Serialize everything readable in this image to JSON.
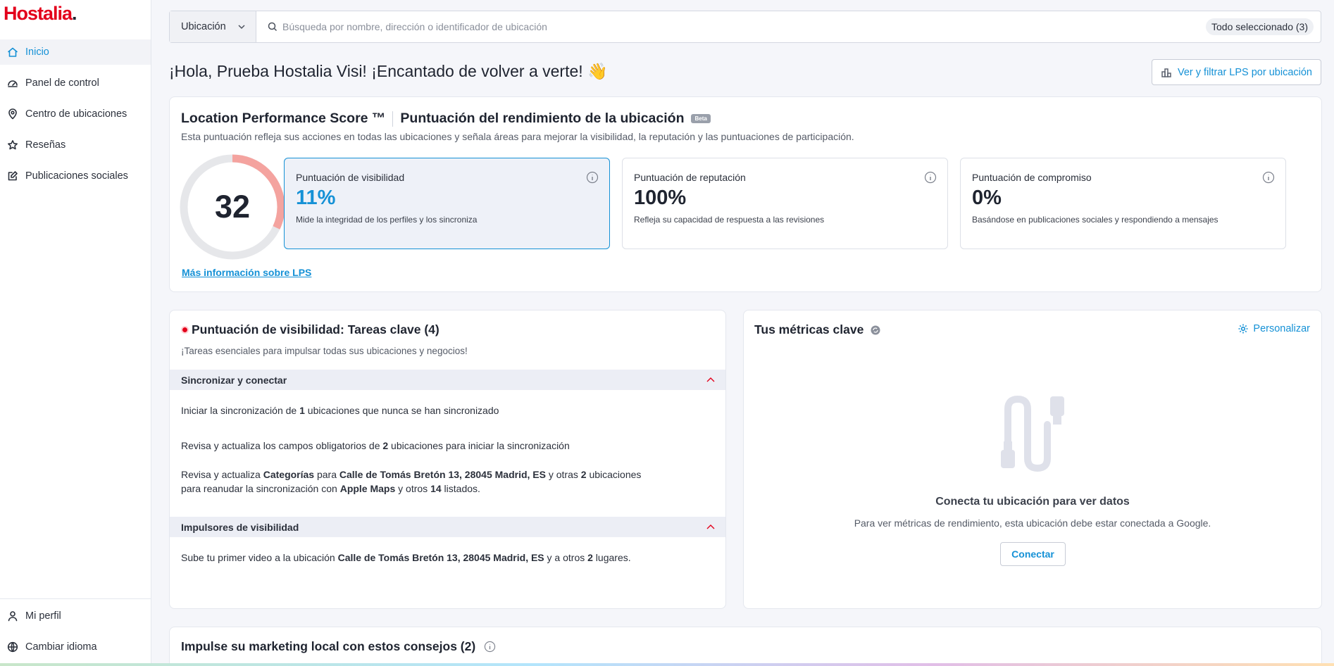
{
  "brand": {
    "name": "Hostalia",
    "dot": ".",
    "accent": "#e3001b",
    "link_color": "#1591d6"
  },
  "sidebar": {
    "items": [
      {
        "label": "Inicio",
        "icon": "home-icon",
        "active": true
      },
      {
        "label": "Panel de control",
        "icon": "dashboard-icon"
      },
      {
        "label": "Centro de ubicaciones",
        "icon": "location-pin-icon"
      },
      {
        "label": "Reseñas",
        "icon": "star-icon"
      },
      {
        "label": "Publicaciones sociales",
        "icon": "edit-post-icon"
      }
    ],
    "bottom_items": [
      {
        "label": "Mi perfil",
        "icon": "user-icon"
      },
      {
        "label": "Cambiar idioma",
        "icon": "globe-icon"
      }
    ]
  },
  "search": {
    "type_label": "Ubicación",
    "placeholder": "Búsqueda por nombre, dirección o identificador de ubicación",
    "selection_badge": "Todo seleccionado (3)"
  },
  "greeting": {
    "text": "¡Hola, Prueba Hostalia Visi! ¡Encantado de volver a verte!",
    "emoji": "👋"
  },
  "filter_button": {
    "label": "Ver y filtrar LPS por ubicación"
  },
  "lps": {
    "title_en": "Location Performance Score ™",
    "title_es": "Puntuación del rendimiento de la ubicación",
    "beta": "Beta",
    "description": "Esta puntuación refleja sus acciones en todas las ubicaciones y señala áreas para mejorar la visibilidad, la reputación y las puntuaciones de participación.",
    "score": "32",
    "score_fraction": 0.32,
    "more_link": "Más información sobre LPS",
    "cards": [
      {
        "label": "Puntuación de visibilidad",
        "value": "11%",
        "desc": "Mide la integridad de los perfiles y los sincroniza",
        "active": true
      },
      {
        "label": "Puntuación de reputación",
        "value": "100%",
        "desc": "Refleja su capacidad de respuesta a las revisiones"
      },
      {
        "label": "Puntuación de compromiso",
        "value": "0%",
        "desc": "Basándose en publicaciones sociales y respondiendo a mensajes"
      }
    ]
  },
  "tasks": {
    "title": "Puntuación de visibilidad: Tareas clave (4)",
    "subtitle": "¡Tareas esenciales para impulsar todas sus ubicaciones y negocios!",
    "section1": "Sincronizar y conectar",
    "task1": {
      "a": "Iniciar la sincronización de ",
      "b": "1",
      "c": " ubicaciones que nunca se han sincronizado"
    },
    "task2": {
      "a": "Revisa y actualiza los campos obligatorios de ",
      "b": "2",
      "c": " ubicaciones para iniciar la sincronización"
    },
    "task3": {
      "a": "Revisa y actualiza ",
      "b": "Categorías",
      "c": " para ",
      "d": "Calle de Tomás Bretón 13, 28045 Madrid, ES",
      "e": " y otras ",
      "f": "2",
      "g": " ubicaciones",
      "h": "para reanudar la sincronización con ",
      "i": "Apple Maps",
      "j": " y otros ",
      "k": "14",
      "l": " listados."
    },
    "section2": "Impulsores de visibilidad",
    "task4": {
      "a": "Sube tu primer video a la ubicación ",
      "b": "Calle de Tomás Bretón 13, 28045 Madrid, ES",
      "c": " y a otros ",
      "d": "2",
      "e": " lugares."
    }
  },
  "metrics": {
    "title": "Tus métricas clave",
    "customize": "Personalizar",
    "empty_title": "Conecta tu ubicación para ver datos",
    "empty_desc": "Para ver métricas de rendimiento, esta ubicación debe estar conectada a Google.",
    "connect": "Conectar"
  },
  "tips": {
    "title": "Impulse su marketing local con estos consejos (2)"
  }
}
